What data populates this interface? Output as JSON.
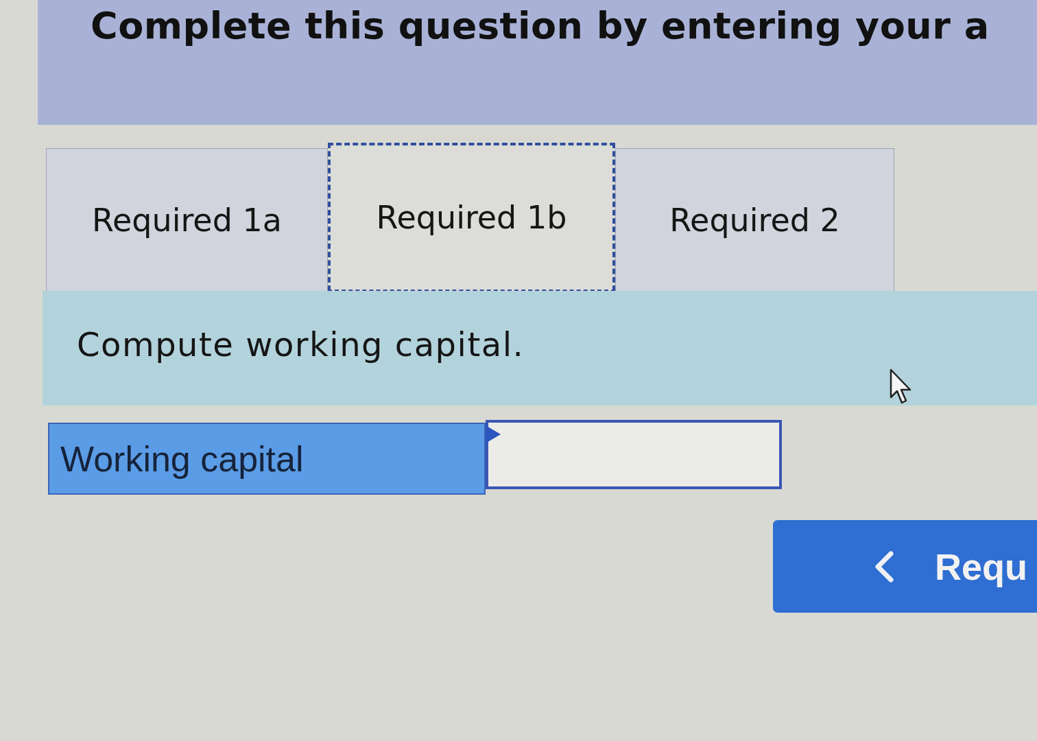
{
  "header": {
    "title": "Complete this question by entering your a"
  },
  "tabs": [
    {
      "label": "Required 1a",
      "selected": false
    },
    {
      "label": "Required 1b",
      "selected": true
    },
    {
      "label": "Required 2",
      "selected": false
    }
  ],
  "instruction": "Compute working capital.",
  "answer_rows": [
    {
      "label": "Working capital"
    }
  ],
  "nav_button": {
    "label": "Requ"
  }
}
